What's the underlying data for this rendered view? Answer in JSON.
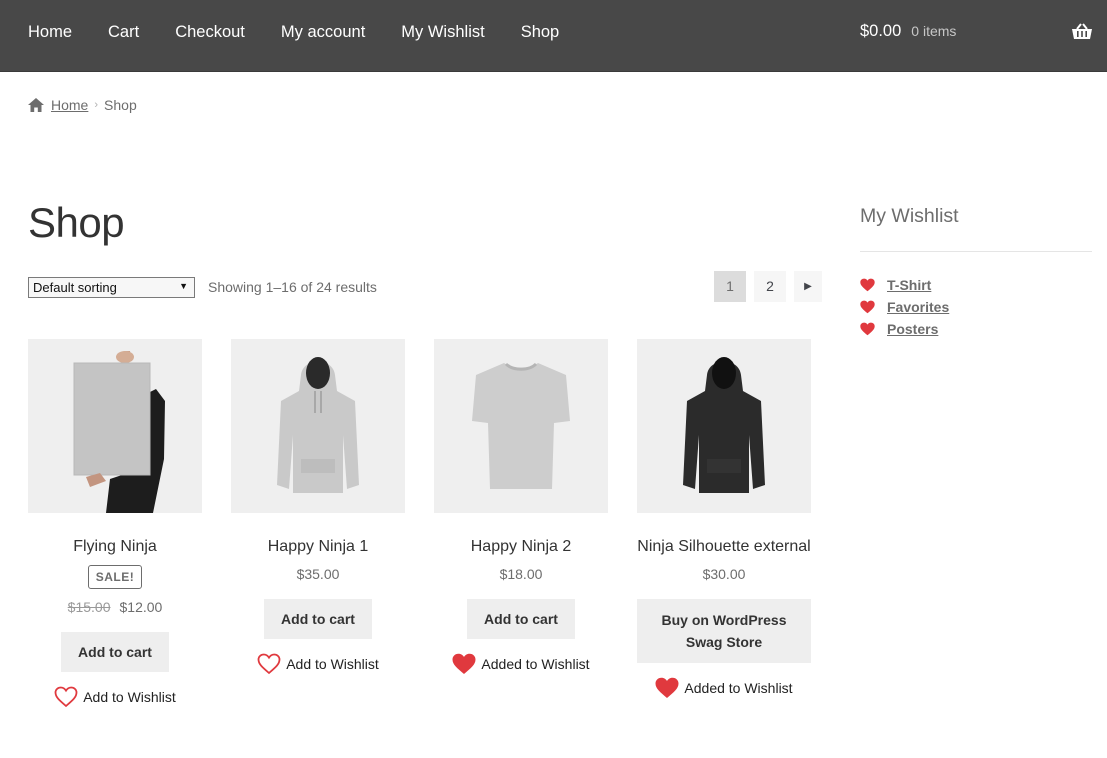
{
  "header": {
    "nav": [
      "Home",
      "Cart",
      "Checkout",
      "My account",
      "My Wishlist",
      "Shop"
    ],
    "cart_total": "$0.00",
    "cart_count": "0 items"
  },
  "breadcrumb": {
    "home": "Home",
    "current": "Shop"
  },
  "main": {
    "title": "Shop",
    "sorting": "Default sorting",
    "result_count": "Showing 1–16 of 24 results",
    "pagination": [
      "1",
      "2"
    ]
  },
  "products": [
    {
      "title": "Flying Ninja",
      "badge": "SALE!",
      "old_price": "$15.00",
      "price": "$12.00",
      "button": "Add to cart",
      "wishlist": "Add to Wishlist",
      "wishlisted": false
    },
    {
      "title": "Happy Ninja 1",
      "price": "$35.00",
      "button": "Add to cart",
      "wishlist": "Add to Wishlist",
      "wishlisted": false
    },
    {
      "title": "Happy Ninja 2",
      "price": "$18.00",
      "button": "Add to cart",
      "wishlist": "Added to Wishlist",
      "wishlisted": true
    },
    {
      "title": "Ninja Silhouette external",
      "price": "$30.00",
      "button_line1": "Buy on WordPress",
      "button_line2": "Swag Store",
      "wishlist": "Added to Wishlist",
      "wishlisted": true
    }
  ],
  "sidebar": {
    "title": "My Wishlist",
    "items": [
      "T-Shirt",
      "Favorites",
      "Posters"
    ]
  },
  "colors": {
    "header_bg": "#484848",
    "heart_red": "#e0393e",
    "button_bg": "#eeeeee"
  }
}
